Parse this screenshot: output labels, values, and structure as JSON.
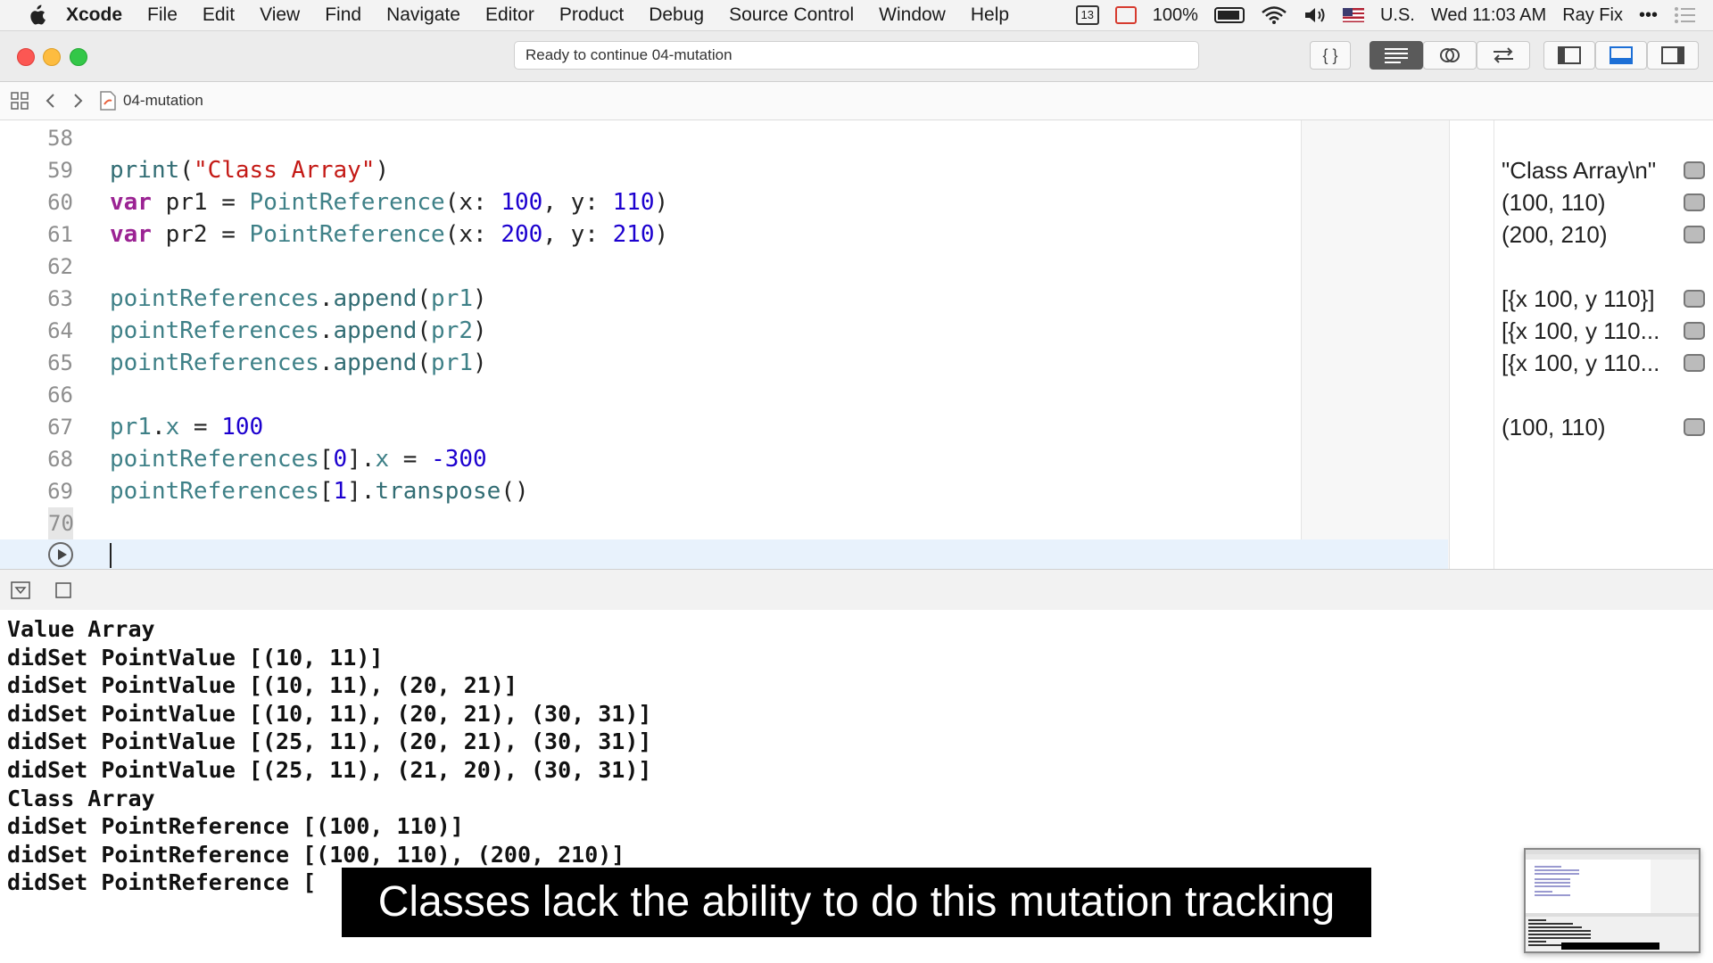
{
  "menubar": {
    "app": "Xcode",
    "items": [
      "File",
      "Edit",
      "View",
      "Find",
      "Navigate",
      "Editor",
      "Product",
      "Debug",
      "Source Control",
      "Window",
      "Help"
    ],
    "calendar_day": "13",
    "battery": "100%",
    "input_source": "U.S.",
    "clock": "Wed 11:03 AM",
    "user": "Ray Fix",
    "more": "•••"
  },
  "toolbar": {
    "activity": "Ready to continue 04-mutation"
  },
  "jumpbar": {
    "file": "04-mutation"
  },
  "editor": {
    "lines": [
      {
        "no": "58",
        "tokens": []
      },
      {
        "no": "59",
        "tokens": [
          [
            "fn",
            "print"
          ],
          [
            "p",
            "("
          ],
          [
            "str",
            "\"Class Array\""
          ],
          [
            "p",
            ")"
          ]
        ]
      },
      {
        "no": "60",
        "tokens": [
          [
            "kw",
            "var"
          ],
          [
            "p",
            " pr1 = "
          ],
          [
            "typ",
            "PointReference"
          ],
          [
            "p",
            "(x: "
          ],
          [
            "num",
            "100"
          ],
          [
            "p",
            ", y: "
          ],
          [
            "num",
            "110"
          ],
          [
            "p",
            ")"
          ]
        ]
      },
      {
        "no": "61",
        "tokens": [
          [
            "kw",
            "var"
          ],
          [
            "p",
            " pr2 = "
          ],
          [
            "typ",
            "PointReference"
          ],
          [
            "p",
            "(x: "
          ],
          [
            "num",
            "200"
          ],
          [
            "p",
            ", y: "
          ],
          [
            "num",
            "210"
          ],
          [
            "p",
            ")"
          ]
        ]
      },
      {
        "no": "62",
        "tokens": []
      },
      {
        "no": "63",
        "tokens": [
          [
            "mem",
            "pointReferences"
          ],
          [
            "p",
            "."
          ],
          [
            "fn",
            "append"
          ],
          [
            "p",
            "("
          ],
          [
            "mem",
            "pr1"
          ],
          [
            "p",
            ")"
          ]
        ]
      },
      {
        "no": "64",
        "tokens": [
          [
            "mem",
            "pointReferences"
          ],
          [
            "p",
            "."
          ],
          [
            "fn",
            "append"
          ],
          [
            "p",
            "("
          ],
          [
            "mem",
            "pr2"
          ],
          [
            "p",
            ")"
          ]
        ]
      },
      {
        "no": "65",
        "tokens": [
          [
            "mem",
            "pointReferences"
          ],
          [
            "p",
            "."
          ],
          [
            "fn",
            "append"
          ],
          [
            "p",
            "("
          ],
          [
            "mem",
            "pr1"
          ],
          [
            "p",
            ")"
          ]
        ]
      },
      {
        "no": "66",
        "tokens": []
      },
      {
        "no": "67",
        "tokens": [
          [
            "mem",
            "pr1"
          ],
          [
            "p",
            "."
          ],
          [
            "mem",
            "x"
          ],
          [
            "p",
            " = "
          ],
          [
            "num",
            "100"
          ]
        ]
      },
      {
        "no": "68",
        "tokens": [
          [
            "mem",
            "pointReferences"
          ],
          [
            "p",
            "["
          ],
          [
            "num",
            "0"
          ],
          [
            "p",
            "]."
          ],
          [
            "mem",
            "x"
          ],
          [
            "p",
            " = "
          ],
          [
            "num",
            "-300"
          ]
        ]
      },
      {
        "no": "69",
        "tokens": [
          [
            "mem",
            "pointReferences"
          ],
          [
            "p",
            "["
          ],
          [
            "num",
            "1"
          ],
          [
            "p",
            "]."
          ],
          [
            "fn",
            "transpose"
          ],
          [
            "p",
            "()"
          ]
        ]
      },
      {
        "no": "70",
        "tokens": []
      }
    ],
    "results": [
      {
        "line": 1,
        "text": "\"Class Array\\n\""
      },
      {
        "line": 2,
        "text": "(100, 110)"
      },
      {
        "line": 3,
        "text": "(200, 210)"
      },
      {
        "line": 5,
        "text": "[{x 100, y 110}]"
      },
      {
        "line": 6,
        "text": "[{x 100, y 110..."
      },
      {
        "line": 7,
        "text": "[{x 100, y 110..."
      },
      {
        "line": 9,
        "text": "(100, 110)"
      }
    ]
  },
  "console": {
    "lines": [
      "Value Array",
      "didSet PointValue [(10, 11)]",
      "didSet PointValue [(10, 11), (20, 21)]",
      "didSet PointValue [(10, 11), (20, 21), (30, 31)]",
      "didSet PointValue [(25, 11), (20, 21), (30, 31)]",
      "didSet PointValue [(25, 11), (21, 20), (30, 31)]",
      "Class Array",
      "didSet PointReference [(100, 110)]",
      "didSet PointReference [(100, 110), (200, 210)]",
      "didSet PointReference ["
    ]
  },
  "caption": "Classes lack the ability to do this mutation tracking"
}
